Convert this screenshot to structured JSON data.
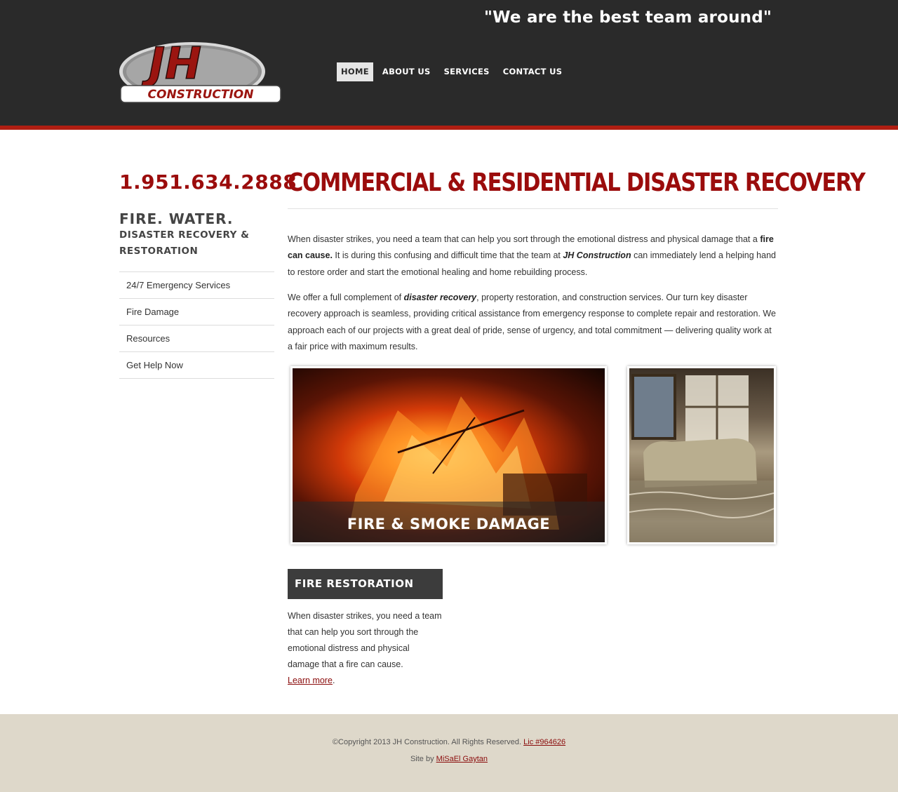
{
  "header": {
    "tagline": "\"We are the best team around\"",
    "logo": {
      "initials": "JH",
      "word": "CONSTRUCTION"
    },
    "nav": [
      {
        "label": "HOME",
        "active": true
      },
      {
        "label": "ABOUT US",
        "active": false
      },
      {
        "label": "SERVICES",
        "active": false
      },
      {
        "label": "CONTACT US",
        "active": false
      }
    ]
  },
  "sidebar": {
    "phone": "1.951.634.2888",
    "heading": "FIRE. WATER.",
    "subheading": "DISASTER RECOVERY & RESTORATION",
    "links": [
      "24/7 Emergency Services",
      "Fire Damage",
      "Resources",
      "Get Help Now"
    ]
  },
  "main": {
    "title": "COMMERCIAL & RESIDENTIAL DISASTER RECOVERY",
    "p1": {
      "a": "When disaster strikes, you need a team that can help you sort through the emotional distress and physical damage that a ",
      "b": "fire can cause.",
      "c": " It is during this confusing and difficult time that the team at ",
      "d": "JH Construction",
      "e": " can immediately lend a helping hand to restore order and start the emotional healing and home rebuilding process."
    },
    "p2": {
      "a": "We offer a full complement of ",
      "b": "disaster recovery",
      "c": ", property restoration, and construction services. Our turn key disaster recovery approach is seamless, providing critical assistance from emergency response to complete repair and restoration. We approach each of our projects with a great deal of pride, sense of urgency, and total commitment — delivering quality work at a fair price with maximum results."
    },
    "fire_caption": "FIRE & SMOKE DAMAGE",
    "box": {
      "heading": "FIRE RESTORATION",
      "text": "When disaster strikes, you need a team that can help you sort through the emotional distress and physical damage that a fire can cause.",
      "link": "Learn more",
      "after_link": "."
    }
  },
  "footer": {
    "copyright": "©Copyright 2013 JH Construction. All Rights Reserved. ",
    "license_link": "Lic #964626",
    "site_by": "Site by ",
    "designer_link": "MiSaEl Gaytan"
  },
  "colors": {
    "header_bg": "#2a2a2a",
    "accent_red": "#9b0c0c",
    "stripe": "#b01e12",
    "footer_bg": "#ded8ca"
  }
}
